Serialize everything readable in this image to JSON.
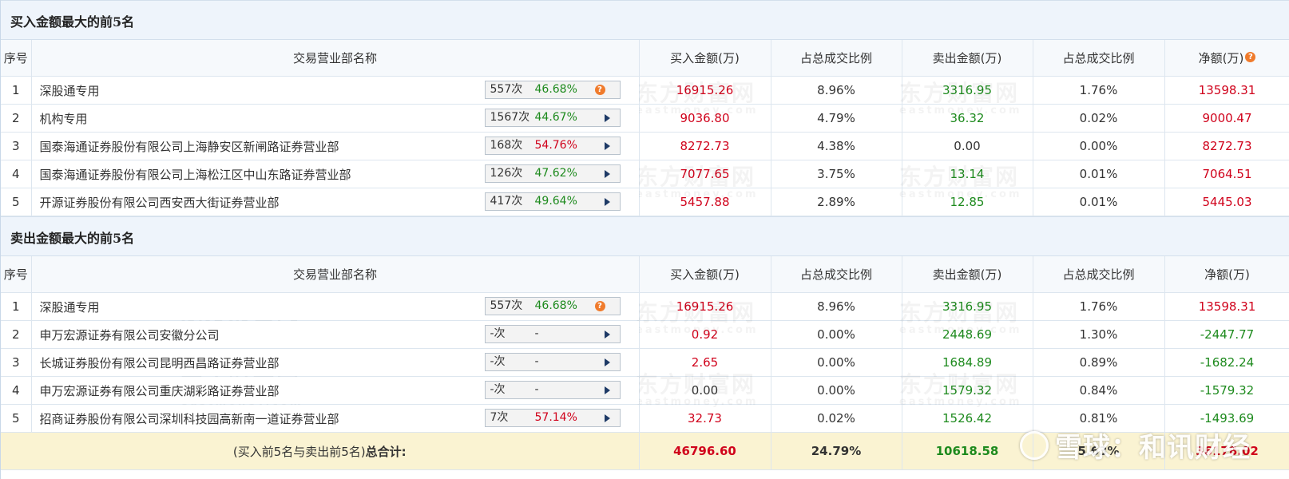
{
  "buy_section": {
    "title": "买入金额最大的前5名",
    "headers": [
      "序号",
      "交易营业部名称",
      "买入金额(万)",
      "占总成交比例",
      "卖出金额(万)",
      "占总成交比例",
      "净额(万)"
    ],
    "rows": [
      {
        "idx": "1",
        "name": "深股通专用",
        "count": "557次",
        "pct": "46.68%",
        "buy": "16915.26",
        "buy_ratio": "8.96%",
        "sell": "3316.95",
        "sell_ratio": "1.76%",
        "net": "13598.31"
      },
      {
        "idx": "2",
        "name": "机构专用",
        "count": "1567次",
        "pct": "44.67%",
        "buy": "9036.80",
        "buy_ratio": "4.79%",
        "sell": "36.32",
        "sell_ratio": "0.02%",
        "net": "9000.47"
      },
      {
        "idx": "3",
        "name": "国泰海通证券股份有限公司上海静安区新闸路证券营业部",
        "count": "168次",
        "pct": "54.76%",
        "buy": "8272.73",
        "buy_ratio": "4.38%",
        "sell": "0.00",
        "sell_ratio": "0.00%",
        "net": "8272.73"
      },
      {
        "idx": "4",
        "name": "国泰海通证券股份有限公司上海松江区中山东路证券营业部",
        "count": "126次",
        "pct": "47.62%",
        "buy": "7077.65",
        "buy_ratio": "3.75%",
        "sell": "13.14",
        "sell_ratio": "0.01%",
        "net": "7064.51"
      },
      {
        "idx": "5",
        "name": "开源证券股份有限公司西安西大街证券营业部",
        "count": "417次",
        "pct": "49.64%",
        "buy": "5457.88",
        "buy_ratio": "2.89%",
        "sell": "12.85",
        "sell_ratio": "0.01%",
        "net": "5445.03"
      }
    ]
  },
  "sell_section": {
    "title": "卖出金额最大的前5名",
    "headers": [
      "序号",
      "交易营业部名称",
      "买入金额(万)",
      "占总成交比例",
      "卖出金额(万)",
      "占总成交比例",
      "净额(万)"
    ],
    "rows": [
      {
        "idx": "1",
        "name": "深股通专用",
        "count": "557次",
        "pct": "46.68%",
        "buy": "16915.26",
        "buy_ratio": "8.96%",
        "sell": "3316.95",
        "sell_ratio": "1.76%",
        "net": "13598.31"
      },
      {
        "idx": "2",
        "name": "申万宏源证券有限公司安徽分公司",
        "count": "-次",
        "pct": "-",
        "buy": "0.92",
        "buy_ratio": "0.00%",
        "sell": "2448.69",
        "sell_ratio": "1.30%",
        "net": "-2447.77"
      },
      {
        "idx": "3",
        "name": "长城证券股份有限公司昆明西昌路证券营业部",
        "count": "-次",
        "pct": "-",
        "buy": "2.65",
        "buy_ratio": "0.00%",
        "sell": "1684.89",
        "sell_ratio": "0.89%",
        "net": "-1682.24"
      },
      {
        "idx": "4",
        "name": "申万宏源证券有限公司重庆湖彩路证券营业部",
        "count": "-次",
        "pct": "-",
        "buy": "0.00",
        "buy_ratio": "0.00%",
        "sell": "1579.32",
        "sell_ratio": "0.84%",
        "net": "-1579.32"
      },
      {
        "idx": "5",
        "name": "招商证券股份有限公司深圳科技园高新南一道证券营业部",
        "count": "7次",
        "pct": "57.14%",
        "buy": "32.73",
        "buy_ratio": "0.02%",
        "sell": "1526.42",
        "sell_ratio": "0.81%",
        "net": "-1493.69"
      }
    ]
  },
  "total": {
    "label_prefix": "(买入前5名与卖出前5名)",
    "label_bold": "总合计:",
    "buy": "46796.60",
    "buy_ratio": "24.79%",
    "sell": "10618.58",
    "sell_ratio": "5.63%",
    "net": "36178.02"
  },
  "watermark": {
    "cn": "东方财富网",
    "en": "eastmoney.com"
  },
  "corner_watermark": "雪球：和讯财经",
  "help_icon_text": "?",
  "colors": {
    "red": "#d0021b",
    "green": "#1d8a1d",
    "header_bg": "#eef4fb",
    "total_bg": "#faf3d2",
    "help_icon": "#f07b2c"
  }
}
